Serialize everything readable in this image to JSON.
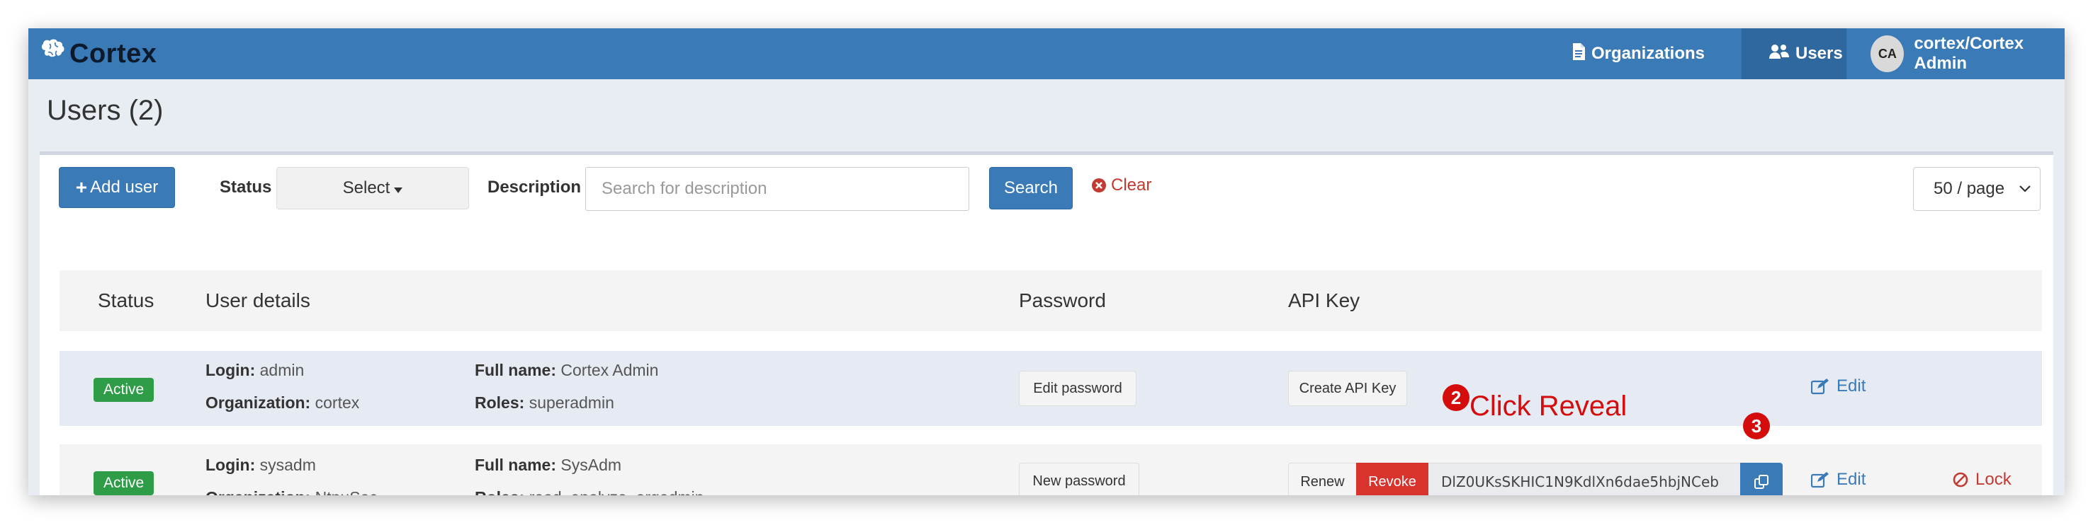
{
  "navbar": {
    "brand": "Cortex",
    "organizations_label": "Organizations",
    "users_label": "Users",
    "user_initials": "CA",
    "user_label": "cortex/Cortex Admin",
    "colors": {
      "bar": "#3a7ab6",
      "active_item": "#2f689e"
    }
  },
  "page": {
    "title": "Users (2)"
  },
  "toolbar": {
    "add_user_label": "Add user",
    "status_label": "Status",
    "status_select_value": "Select",
    "description_label": "Description",
    "description_placeholder": "Search for description",
    "search_label": "Search",
    "clear_label": "Clear",
    "per_page_value": "50 / page"
  },
  "table": {
    "headers": [
      "Status",
      "User details",
      "Password",
      "API Key"
    ],
    "rows": [
      {
        "status": "Active",
        "login_label": "Login:",
        "login": "admin",
        "org_label": "Organization:",
        "organization": "cortex",
        "fullname_label": "Full name:",
        "full_name": "Cortex Admin",
        "roles_label": "Roles:",
        "roles": "superadmin",
        "password_action": "Edit password",
        "api_action": "Create API Key",
        "edit_label": "Edit"
      },
      {
        "status": "Active",
        "login_label": "Login:",
        "login": "sysadm",
        "org_label": "Organization:",
        "organization": "NtpuSoc",
        "fullname_label": "Full name:",
        "full_name": "SysAdm",
        "roles_label": "Roles:",
        "roles": "read, analyze, orgadmin",
        "password_action": "New password",
        "renew_label": "Renew",
        "revoke_label": "Revoke",
        "api_key": "DlZ0UKsSKHIC1N9KdlXn6dae5hbjNCeb",
        "edit_label": "Edit",
        "lock_label": "Lock"
      }
    ]
  },
  "annotations": {
    "step2": "2",
    "step2_text": "Click Reveal",
    "step3": "3",
    "color": "#d40c0c"
  },
  "icons": [
    "brain-icon",
    "document-icon",
    "users-icon",
    "plus-icon",
    "caret-down-icon",
    "times-circle-icon",
    "chevron-down-icon",
    "copy-icon",
    "edit-icon",
    "ban-icon"
  ]
}
